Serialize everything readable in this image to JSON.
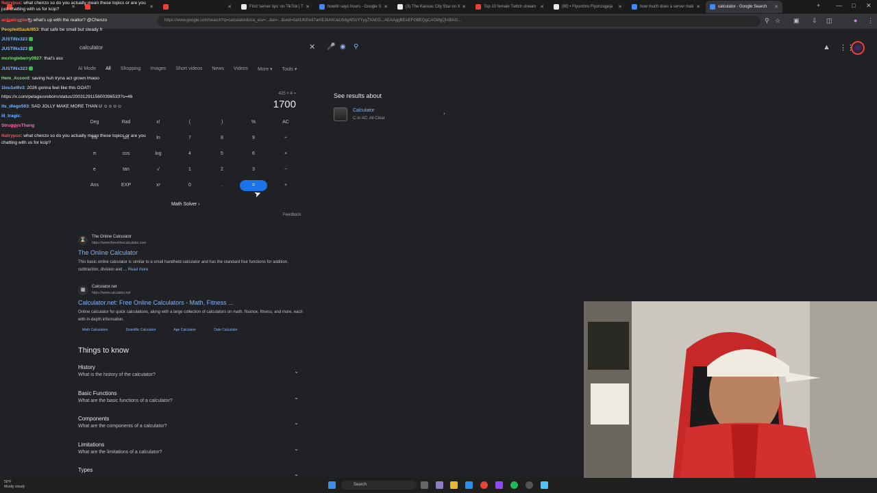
{
  "browser": {
    "tabs": [
      {
        "label": "",
        "color": "#e94235"
      },
      {
        "label": "",
        "color": "#e94235"
      },
      {
        "label": "",
        "color": "#e94235"
      },
      {
        "label": "Find 'server tips' on TikTok | T",
        "color": "#e8eaed"
      },
      {
        "label": "how/in says hours - Google S",
        "color": "#4285f4"
      },
      {
        "label": "(3) The Kansas City Star on X",
        "color": "#e8eaed"
      },
      {
        "label": "Top 10 female Twitch stream",
        "color": "#e94235"
      },
      {
        "label": "(Bf) • Flyumbro Flyonzugeja",
        "color": "#e8eaed"
      },
      {
        "label": "how much does a server mak",
        "color": "#4285f4"
      },
      {
        "label": "calculator - Google Search",
        "color": "#4285f4",
        "active": true
      }
    ],
    "url": "https://www.google.com/search?q=calculator&sca_esv=...&ei=...&ved=0ahUKEwiI7ar0EJkAhUaU5dgAEi1YYyg7XAEG...AEAAggBEAEFGBEQgCAGMgQIABAG..."
  },
  "google": {
    "query": "calculator",
    "filters": [
      {
        "label": "AI Mode"
      },
      {
        "label": "All",
        "active": true
      },
      {
        "label": "Shopping"
      },
      {
        "label": "Images"
      },
      {
        "label": "Short videos"
      },
      {
        "label": "News"
      },
      {
        "label": "Videos"
      },
      {
        "label": "More ▾"
      },
      {
        "label": "Tools ▾"
      }
    ],
    "calculator": {
      "expression": "425 × 4 =",
      "result": "1700",
      "rows": [
        [
          "Deg",
          "Rad",
          "x!",
          "(",
          ")",
          "%",
          "AC"
        ],
        [
          "Inv",
          "sin",
          "ln",
          "7",
          "8",
          "9",
          "÷"
        ],
        [
          "π",
          "cos",
          "log",
          "4",
          "5",
          "6",
          "×"
        ],
        [
          "e",
          "tan",
          "√",
          "1",
          "2",
          "3",
          "−"
        ],
        [
          "Ans",
          "EXP",
          "xʸ",
          "0",
          ".",
          "=",
          "+"
        ]
      ],
      "math_solver": "Math Solver",
      "feedback": "Feedback"
    },
    "knowledge_panel": {
      "heading": "See results about",
      "name": "Calculator",
      "sub": "C or AC: All Clear"
    },
    "results": [
      {
        "site": "The Online Calculator",
        "url": "https://www.theonlinecalculator.com",
        "title": "The Online Calculator",
        "snippet": "This basic online calculator is similar to a small handheld calculator and has the standard four functions for addition, subtraction, division and ...",
        "more": "Read more"
      },
      {
        "site": "Calculator.net",
        "url": "https://www.calculator.net",
        "title": "Calculator.net: Free Online Calculators - Math, Fitness ...",
        "snippet": "Online calculator for quick calculations, along with a large collection of calculators on math, finance, fitness, and more, each with in-depth information.",
        "more": ""
      }
    ],
    "sitelinks": [
      "Math Calculators",
      "Scientific Calculator",
      "Age Calculator",
      "Date Calculator"
    ],
    "things_to_know": {
      "title": "Things to know",
      "items": [
        {
          "heading": "History",
          "question": "What is the history of the calculator?"
        },
        {
          "heading": "Basic Functions",
          "question": "What are the basic functions of a calculator?"
        },
        {
          "heading": "Components",
          "question": "What are the components of a calculator?"
        },
        {
          "heading": "Limitations",
          "question": "What are the limitations of a calculator?"
        },
        {
          "heading": "Types",
          "question": ""
        }
      ]
    }
  },
  "chat": [
    {
      "user": "Natrypux",
      "color": "#ff4b4b",
      "text": ": what chenzo so do you actually mean these topics or are you"
    },
    {
      "user": "",
      "color": "#ff4b4b",
      "text": "just chatting with us for kcip?"
    },
    {
      "user": "actualcontent",
      "color": "#ff4b4b",
      "text": ": what's up with the realtor? @Chenzo"
    },
    {
      "user": "PeopledSauk/653",
      "color": "#f0c050",
      "text": ": that safe be small but steady fr"
    },
    {
      "user": "JUSTINx323",
      "color": "#7ab8ff",
      "text": ""
    },
    {
      "user": "JUSTINx323",
      "color": "#7ab8ff",
      "text": ""
    },
    {
      "user": "mcringleberry0927",
      "color": "#7ee07e",
      "text": ": that's ass"
    },
    {
      "user": "JUSTINx323",
      "color": "#7ab8ff",
      "text": ""
    },
    {
      "user": "Hem_Accord",
      "color": "#7ee07e",
      "text": ": saving huh tryna act grown lmaoo"
    },
    {
      "user": "1lou1el0v3",
      "color": "#7ab8ff",
      "text": ": 2026 gonna feel like this GOAT!"
    },
    {
      "user": "",
      "color": "#7ab8ff",
      "text": "https://x.com/pelagiusreborn/status/2003129115600396533?s=46"
    },
    {
      "user": "its_diego503",
      "color": "#7ab8ff",
      "text": ": SAD JOLLY MAKE MORE THAN U ☺☺☺☺"
    },
    {
      "user": "lil_tragic",
      "color": "#7ab8ff",
      "text": ":"
    },
    {
      "user": "StruggysThang",
      "color": "#ff6ab0",
      "text": ""
    },
    {
      "user": "Natrypux",
      "color": "#ff4b4b",
      "text": ": what chenzo so do you actually mean these topics or are you"
    },
    {
      "user": "",
      "color": "#ff4b4b",
      "text": "chatting with us for kcip?"
    }
  ],
  "taskbar": {
    "weather": "50°F",
    "weather_desc": "Mostly cloudy",
    "search_placeholder": "Search"
  },
  "colors": {
    "accent": "#1a73e8",
    "link": "#8ab4f8"
  }
}
